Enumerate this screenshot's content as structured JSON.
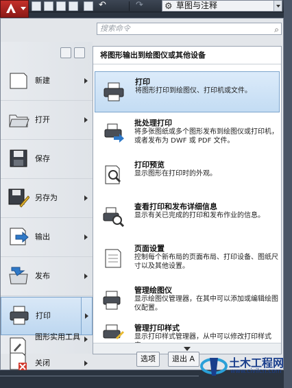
{
  "workspace": {
    "label": "草图与注释"
  },
  "search": {
    "placeholder": "搜索命令"
  },
  "left_menu": {
    "items": [
      {
        "label": "新建",
        "icon": "new-doc-icon"
      },
      {
        "label": "打开",
        "icon": "open-folder-icon"
      },
      {
        "label": "保存",
        "icon": "save-disk-icon"
      },
      {
        "label": "另存为",
        "icon": "save-as-icon"
      },
      {
        "label": "输出",
        "icon": "export-icon"
      },
      {
        "label": "发布",
        "icon": "publish-icon"
      },
      {
        "label": "打印",
        "icon": "printer-icon"
      },
      {
        "label": "图形实用工具",
        "icon": "wrench-icon"
      },
      {
        "label": "关闭",
        "icon": "close-doc-icon"
      }
    ]
  },
  "panel": {
    "header": "将图形输出到绘图仪或其他设备",
    "options": [
      {
        "title": "打印",
        "desc": "将图形打印到绘图仪、打印机或文件。"
      },
      {
        "title": "批处理打印",
        "desc": "将多张图纸或多个图形发布到绘图仪或打印机，或者发布为 DWF 或 PDF 文件。"
      },
      {
        "title": "打印预览",
        "desc": "显示图形在打印时的外观。"
      },
      {
        "title": "查看打印和发布详细信息",
        "desc": "显示有关已完成的打印和发布作业的信息。"
      },
      {
        "title": "页面设置",
        "desc": "控制每个新布局的页面布局、打印设备、图纸尺寸以及其他设置。"
      },
      {
        "title": "管理绘图仪",
        "desc": "显示绘图仪管理器，在其中可以添加或编辑绘图仪配置。"
      },
      {
        "title": "管理打印样式",
        "desc": "显示打印样式管理器，从中可以修改打印样式表。"
      }
    ]
  },
  "footer": {
    "options_label": "选项",
    "exit_label": "退出 A"
  },
  "watermark": {
    "title": "土木工程网",
    "url": "www.civilcn.com"
  },
  "colors": {
    "selection": "#c3dcf3",
    "app_red": "#c4302b",
    "chrome": "#2b3440"
  }
}
